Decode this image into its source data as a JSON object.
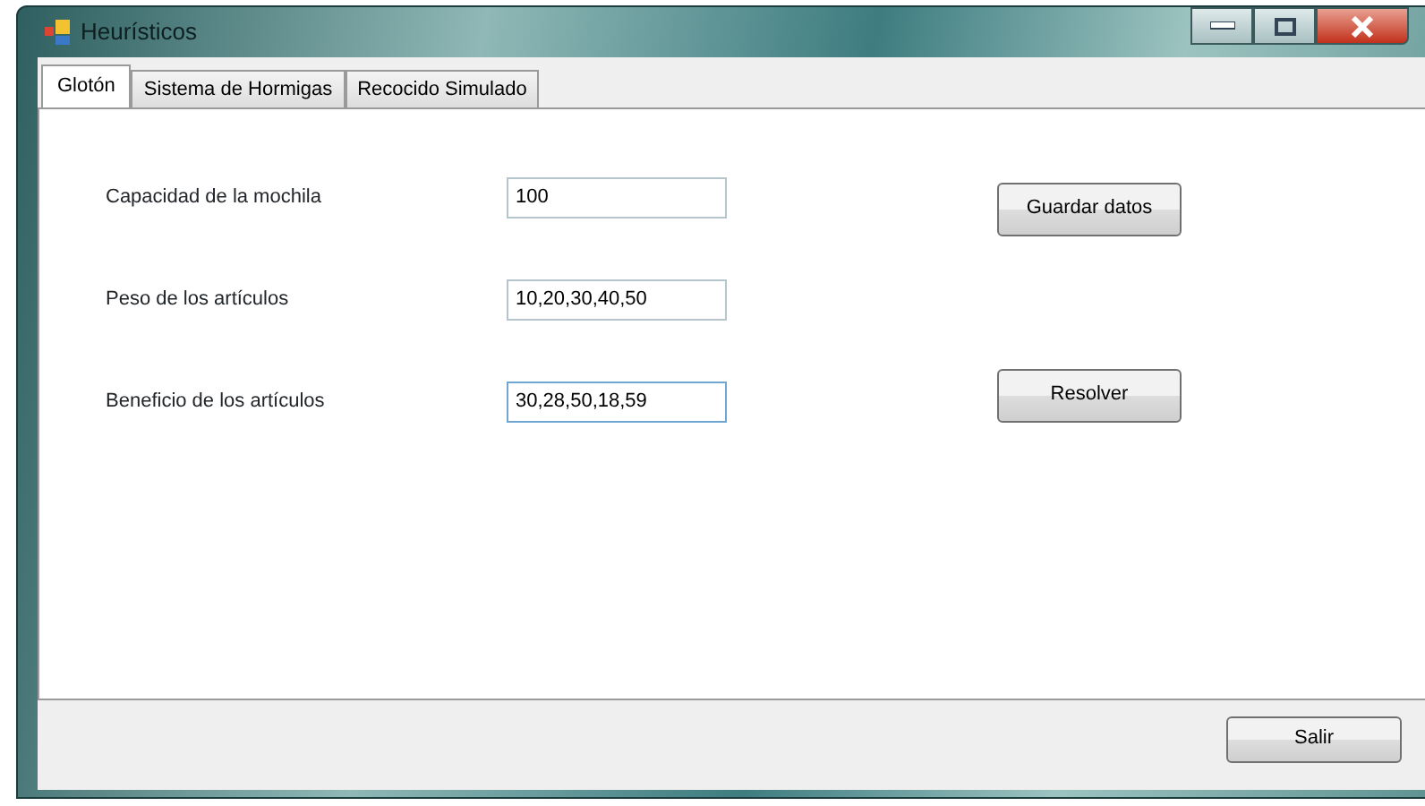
{
  "window": {
    "title": "Heurísticos"
  },
  "tabs": [
    {
      "label": "Glotón",
      "selected": true
    },
    {
      "label": "Sistema de Hormigas",
      "selected": false
    },
    {
      "label": "Recocido Simulado",
      "selected": false
    }
  ],
  "fields": [
    {
      "label": "Capacidad de la mochila",
      "value": "100",
      "focused": false,
      "button": "Guardar datos"
    },
    {
      "label": "Peso de los artículos",
      "value": "10,20,30,40,50",
      "focused": false
    },
    {
      "label": "Beneficio de los artículos",
      "value": "30,28,50,18,59",
      "focused": true,
      "button": "Resolver"
    }
  ],
  "footer_button": "Salir"
}
